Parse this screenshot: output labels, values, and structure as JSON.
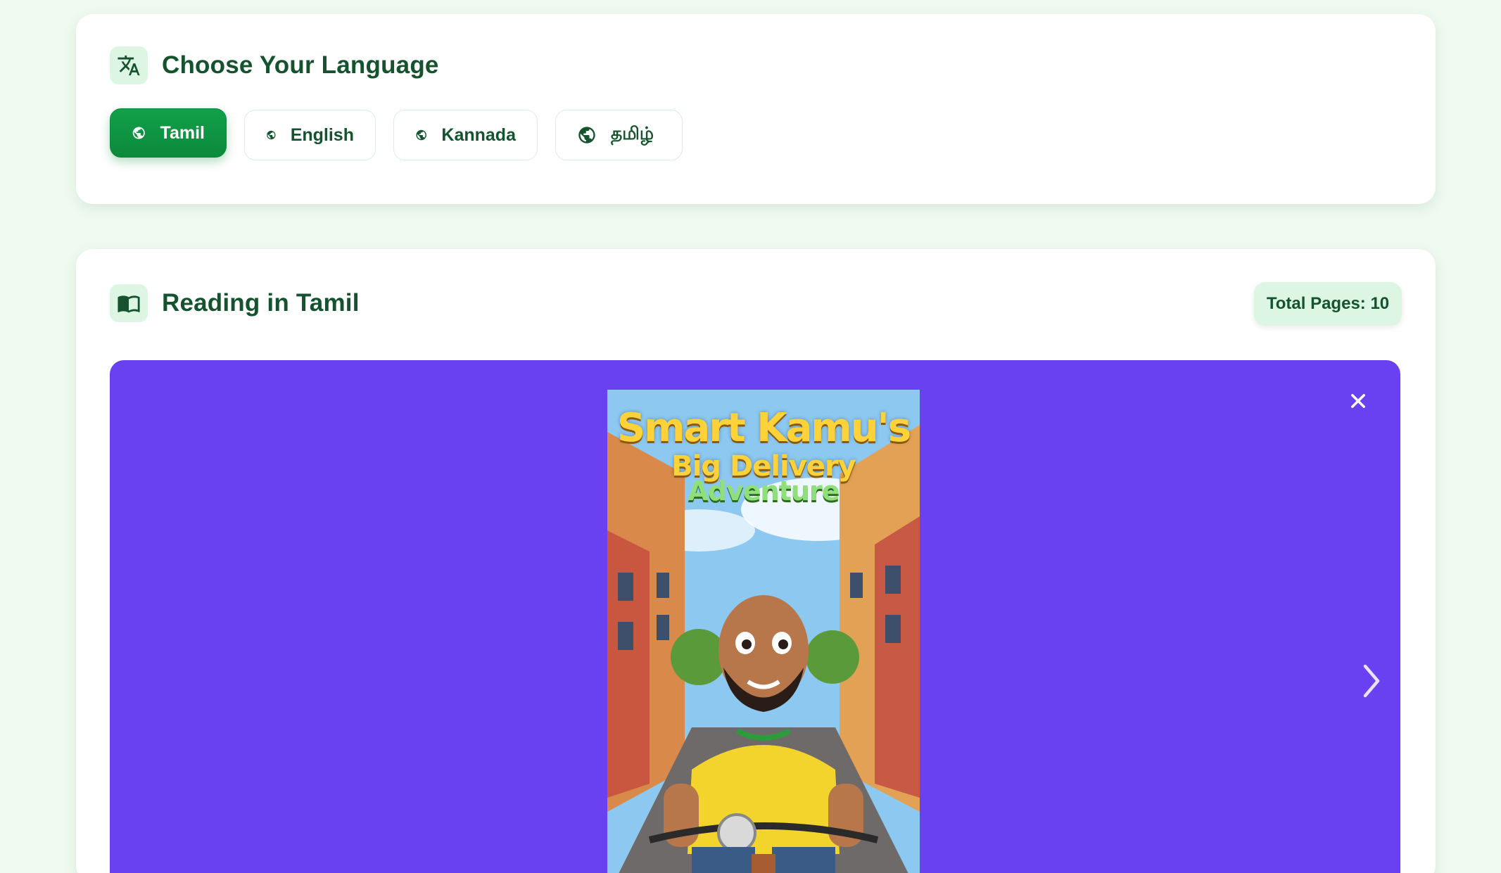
{
  "language_card": {
    "title": "Choose Your Language",
    "icon": "translate-icon",
    "languages": [
      {
        "label": "Tamil",
        "active": true,
        "icon": "globe-icon"
      },
      {
        "label": "English",
        "active": false,
        "icon": "globe-icon"
      },
      {
        "label": "Kannada",
        "active": false,
        "icon": "globe-icon"
      },
      {
        "label": "தமிழ்",
        "active": false,
        "icon": "globe-icon"
      }
    ]
  },
  "reading_card": {
    "title": "Reading in Tamil",
    "icon": "book-open-icon",
    "total_pages_label": "Total Pages: 10",
    "viewer": {
      "background_color": "#6941f0",
      "close_icon": "close-icon",
      "next_icon": "chevron-right-icon",
      "cover": {
        "title_line1": "Smart Kamu's",
        "title_line2": "Big Delivery",
        "title_line3": "Adventure"
      }
    }
  },
  "colors": {
    "accent": "#0b8a3b",
    "heading": "#14532d",
    "badge_bg": "#dcf6e3",
    "page_bg": "#effaf1"
  }
}
